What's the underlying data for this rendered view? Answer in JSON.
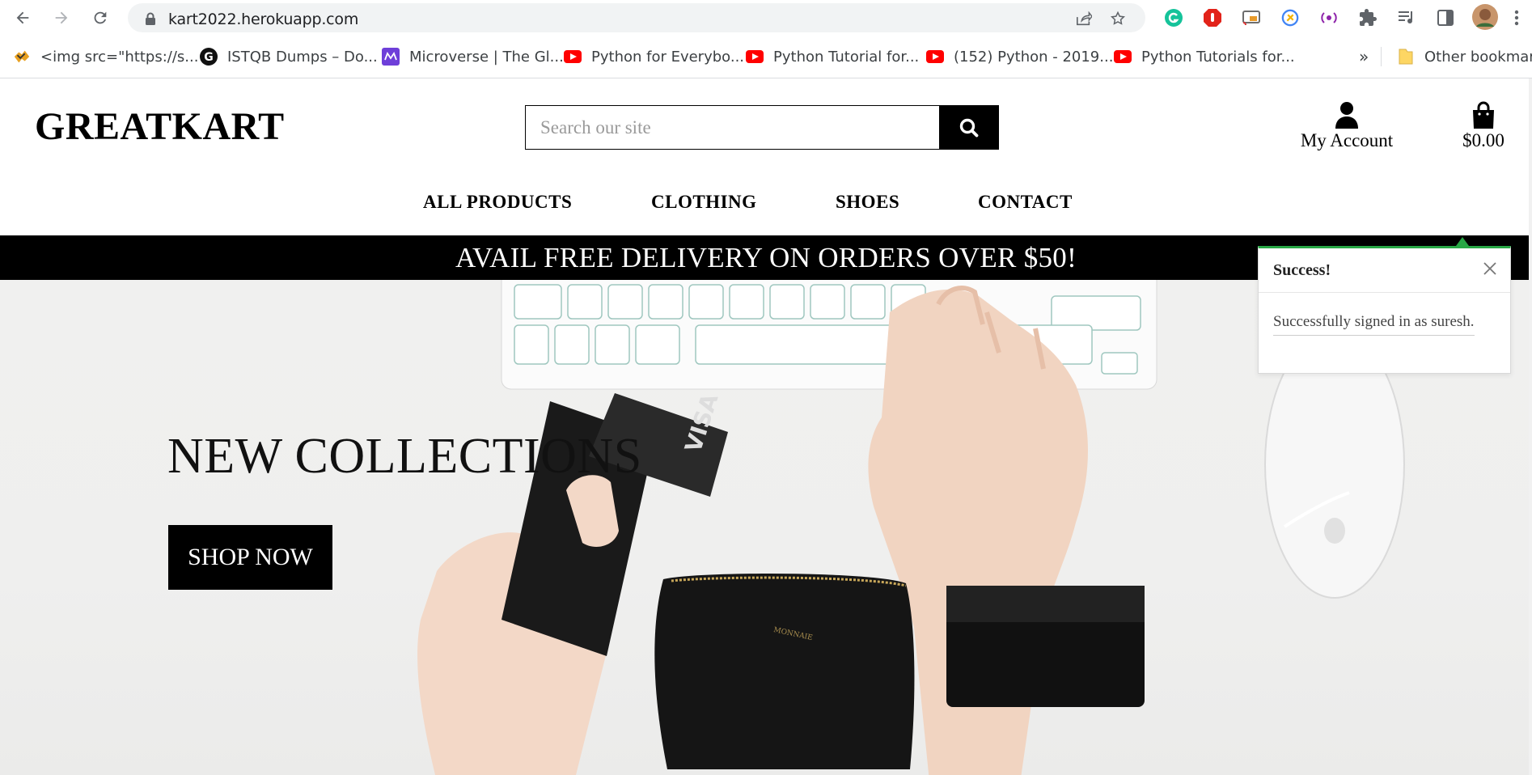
{
  "browser": {
    "url": "kart2022.herokuapp.com",
    "bookmarks": [
      {
        "label": "<img src=\"https://s...",
        "icon": "custom-favicon"
      },
      {
        "label": "ISTQB Dumps – Do...",
        "icon": "g-favicon"
      },
      {
        "label": "Microverse | The Gl...",
        "icon": "microverse-favicon"
      },
      {
        "label": "Python for Everybo...",
        "icon": "youtube-icon"
      },
      {
        "label": "Python Tutorial for...",
        "icon": "youtube-icon"
      },
      {
        "label": "(152) Python - 2019...",
        "icon": "youtube-icon"
      },
      {
        "label": "Python Tutorials for...",
        "icon": "youtube-icon"
      }
    ],
    "more_bookmarks": "»",
    "other_bookmarks": "Other bookmarks"
  },
  "site": {
    "logo": "GREATKART",
    "search_placeholder": "Search our site",
    "account_label": "My Account",
    "cart_total": "$0.00",
    "menu": [
      "ALL PRODUCTS",
      "CLOTHING",
      "SHOES",
      "CONTACT"
    ],
    "promo": "AVAIL FREE DELIVERY ON ORDERS OVER $50!"
  },
  "hero": {
    "title": "NEW COLLECTIONS",
    "button": "SHOP NOW"
  },
  "toast": {
    "title": "Success!",
    "message": "Successfully signed in as suresh."
  },
  "colors": {
    "brand": "#000000",
    "success": "#28a745",
    "promo_text": "#ffffff"
  }
}
